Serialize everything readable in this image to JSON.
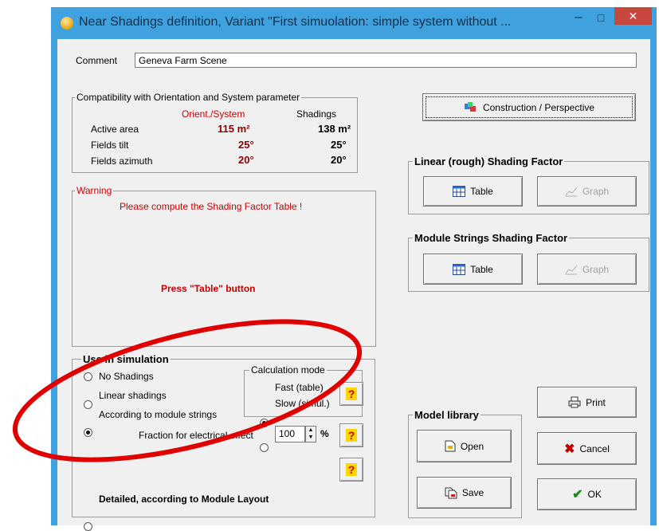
{
  "window": {
    "title": "Near Shadings definition, Variant \"First simuolation: simple system without ...",
    "minimize_glyph": "–",
    "maximize_glyph": "□",
    "close_glyph": "✕"
  },
  "comment": {
    "label": "Comment",
    "value": "Geneva Farm Scene"
  },
  "compat": {
    "title": "Compatibility with Orientation and System parameter",
    "col_orient": "Orient./System",
    "col_shadings": "Shadings",
    "rows": [
      {
        "label": "Active area",
        "orient": "115 m²",
        "shadings": "138 m²"
      },
      {
        "label": "Fields tilt",
        "orient": "25°",
        "shadings": "25°"
      },
      {
        "label": "Fields azimuth",
        "orient": "20°",
        "shadings": "20°"
      }
    ]
  },
  "warning": {
    "title": "Warning",
    "message": "Please compute the Shading Factor Table !",
    "press": "Press \"Table\" button"
  },
  "use_in_simulation": {
    "title": "Use in simulation",
    "options": [
      "No Shadings",
      "Linear shadings",
      "According to module strings"
    ],
    "selected": 2,
    "fraction_label": "Fraction for electrical effect",
    "fraction_value": "100",
    "fraction_unit": "%",
    "detailed": "Detailed, according to Module Layout"
  },
  "calc_mode": {
    "title": "Calculation mode",
    "options": [
      "Fast (table)",
      "Slow (simul.)"
    ],
    "selected": 0
  },
  "construction_button": "Construction / Perspective",
  "linear_factor": {
    "title": "Linear (rough)  Shading Factor",
    "table": "Table",
    "graph": "Graph"
  },
  "module_factor": {
    "title": "Module Strings Shading Factor",
    "table": "Table",
    "graph": "Graph"
  },
  "model_library": {
    "title": "Model library",
    "open": "Open",
    "save": "Save"
  },
  "buttons": {
    "print": "Print",
    "cancel": "Cancel",
    "ok": "OK"
  },
  "help_glyph": "?",
  "colors": {
    "titlebar": "#3fa1dd",
    "annotation": "#e00000",
    "accent_red": "#8b0000"
  }
}
